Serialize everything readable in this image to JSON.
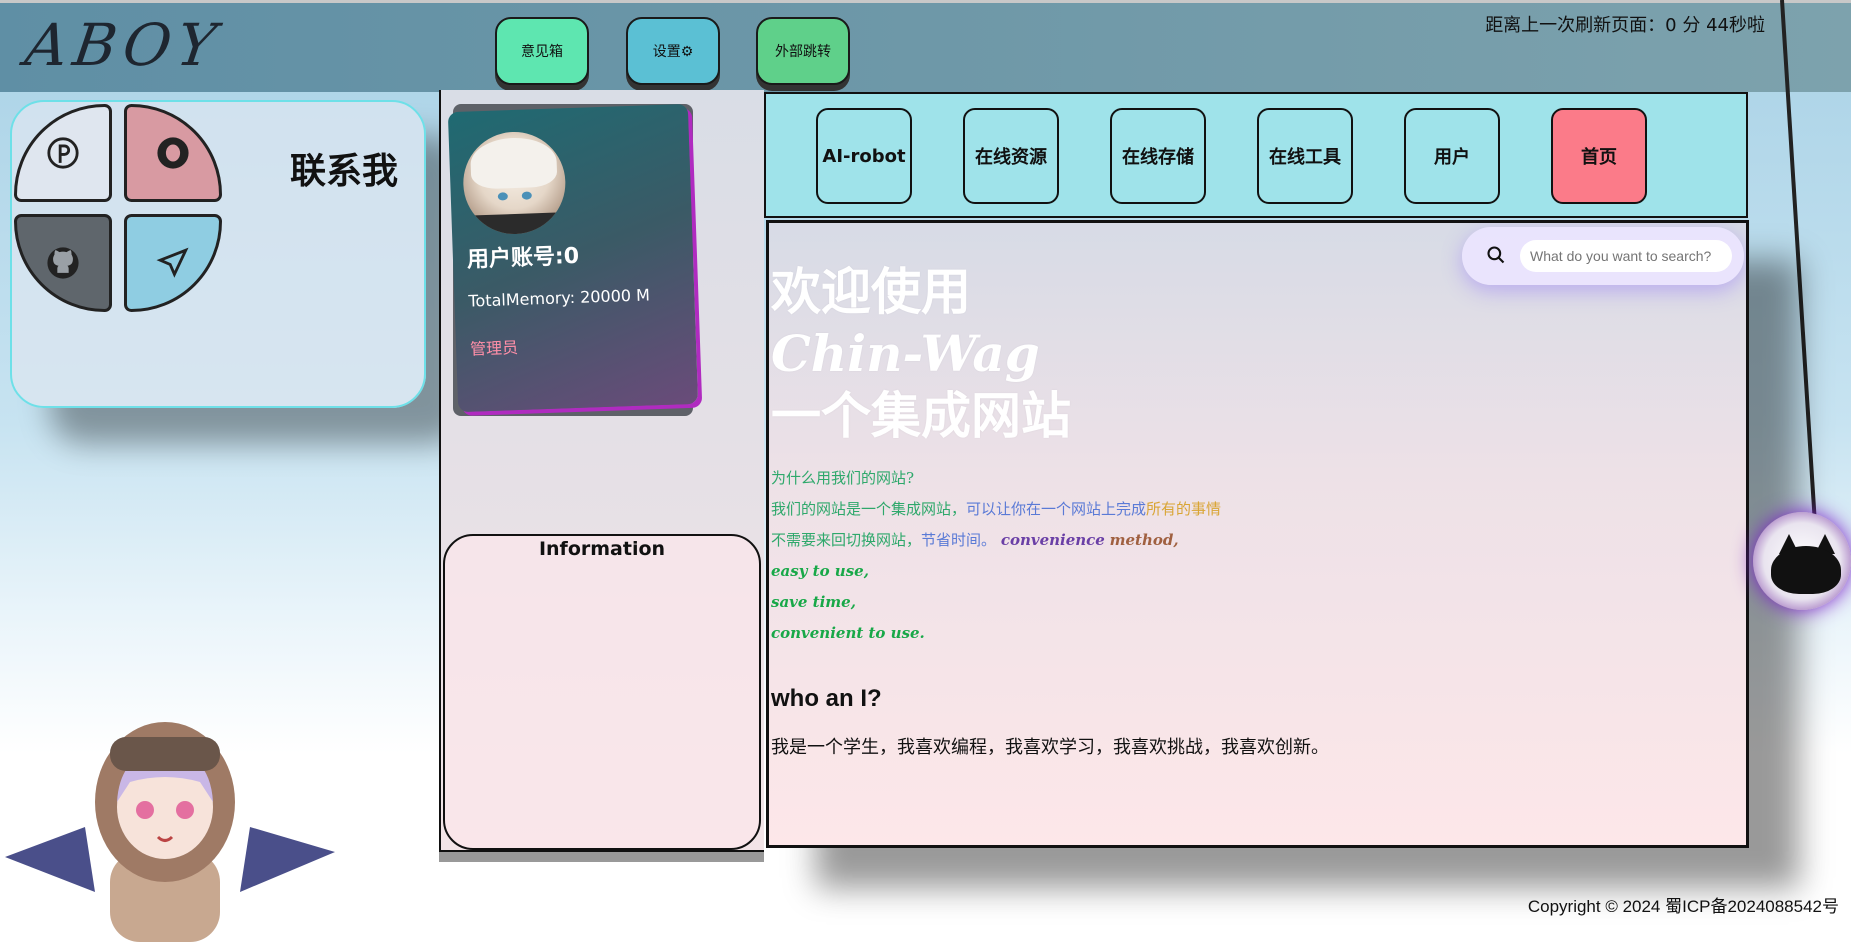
{
  "header": {
    "logo": "ABOY",
    "buttons": [
      {
        "label": "意见箱",
        "color": "#5ee6b0"
      },
      {
        "label": "设置⚙",
        "color": "#5bc0d4"
      },
      {
        "label": "外部跳转",
        "color": "#5fd08a"
      }
    ],
    "refresh_text": "距离上一次刷新页面：0 分 44秒啦"
  },
  "contact": {
    "title": "联系我",
    "icons": [
      "pinterest-icon",
      "qq-icon",
      "github-icon",
      "send-icon"
    ]
  },
  "profile": {
    "account": "用户账号:0",
    "memory": "TotalMemory: 20000 M",
    "role": "管理员"
  },
  "info": {
    "title": "Information"
  },
  "nav": {
    "items": [
      {
        "label": "AI-robot"
      },
      {
        "label": "在线资源"
      },
      {
        "label": "在线存储"
      },
      {
        "label": "在线工具"
      },
      {
        "label": "用户"
      },
      {
        "label": "首页"
      }
    ]
  },
  "search": {
    "placeholder": "What do you want to search?"
  },
  "main": {
    "welcome1": "欢迎使用",
    "welcome2": "Chin-Wag",
    "welcome3": "一个集成网站",
    "q": "为什么用我们的网站?",
    "line2a": "我们的网站是一个集成网站，",
    "line2b": "可以让你在一个网站上完成",
    "line2c": "所有的事情",
    "line3a": "不需要来回切换网站，",
    "line3b": "节省时间。",
    "line3c": "convenience",
    "line3d": "method,",
    "line4": "easy to use,",
    "line5": "save time,",
    "line6": "convenient to use.",
    "who": "who an I?",
    "desc": "我是一个学生，我喜欢编程，我喜欢学习，我喜欢挑战，我喜欢创新。"
  },
  "footer": {
    "copyright": "Copyright © 2024 蜀ICP备2024088542号"
  }
}
